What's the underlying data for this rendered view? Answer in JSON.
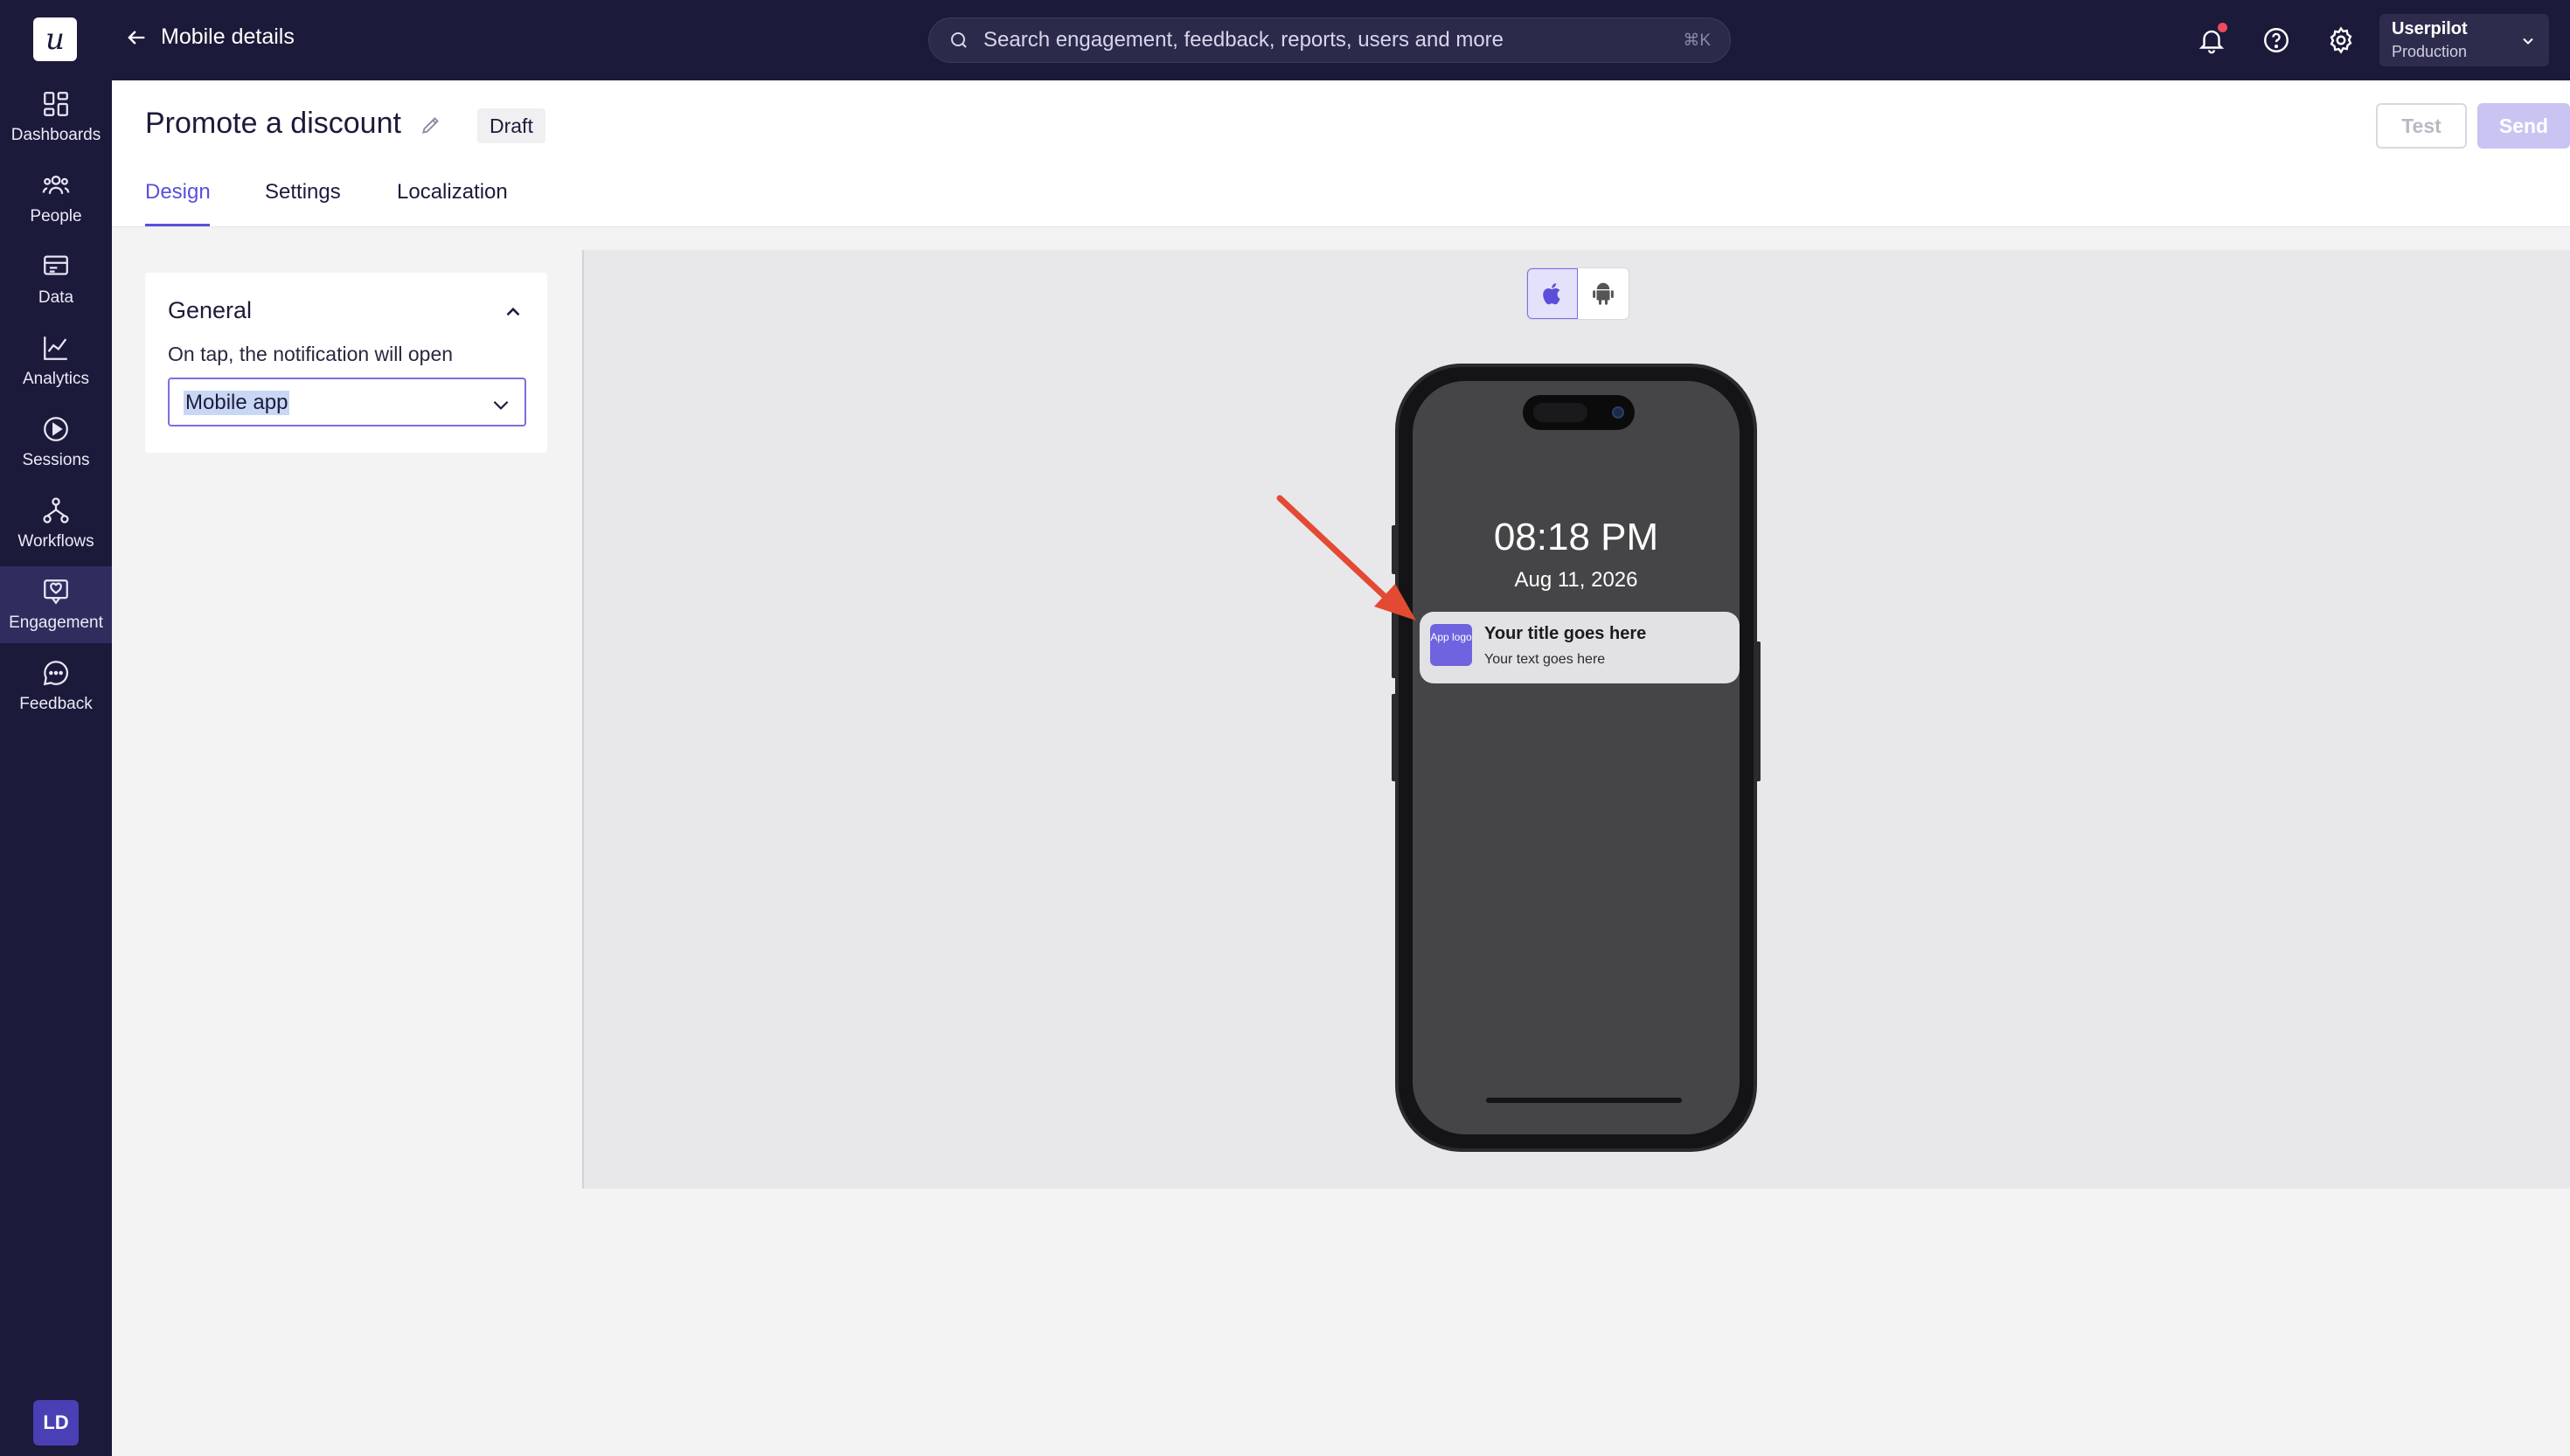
{
  "sidebar": {
    "logo": "u",
    "items": [
      {
        "label": "Dashboards",
        "icon": "dashboards-icon"
      },
      {
        "label": "People",
        "icon": "people-icon"
      },
      {
        "label": "Data",
        "icon": "data-icon"
      },
      {
        "label": "Analytics",
        "icon": "analytics-icon"
      },
      {
        "label": "Sessions",
        "icon": "sessions-icon"
      },
      {
        "label": "Workflows",
        "icon": "workflows-icon"
      },
      {
        "label": "Engagement",
        "icon": "engagement-icon",
        "active": true
      },
      {
        "label": "Feedback",
        "icon": "feedback-icon"
      }
    ],
    "avatar": "LD"
  },
  "topbar": {
    "back_label": "Mobile details",
    "search_placeholder": "Search engagement, feedback, reports, users and more",
    "search_shortcut": "⌘K",
    "workspace_name": "Userpilot",
    "workspace_env": "Production"
  },
  "header": {
    "title": "Promote a discount",
    "status": "Draft",
    "test_label": "Test",
    "send_label": "Send",
    "more_label": "•••",
    "tabs": [
      {
        "label": "Design",
        "active": true
      },
      {
        "label": "Settings"
      },
      {
        "label": "Localization"
      }
    ]
  },
  "general": {
    "title": "General",
    "label": "On tap, the notification will open",
    "selected": "Mobile app"
  },
  "preview": {
    "os_options": [
      "ios",
      "android"
    ],
    "selected_os": "ios",
    "time": "08:18 PM",
    "date": "Aug 11, 2026",
    "notification": {
      "logo_text": "App logo",
      "title": "Your title goes here",
      "text": "Your text goes here"
    }
  },
  "colors": {
    "sidebar_bg": "#1b1a3a",
    "accent": "#5b4fd9",
    "annotation_arrow": "#e34a33"
  }
}
